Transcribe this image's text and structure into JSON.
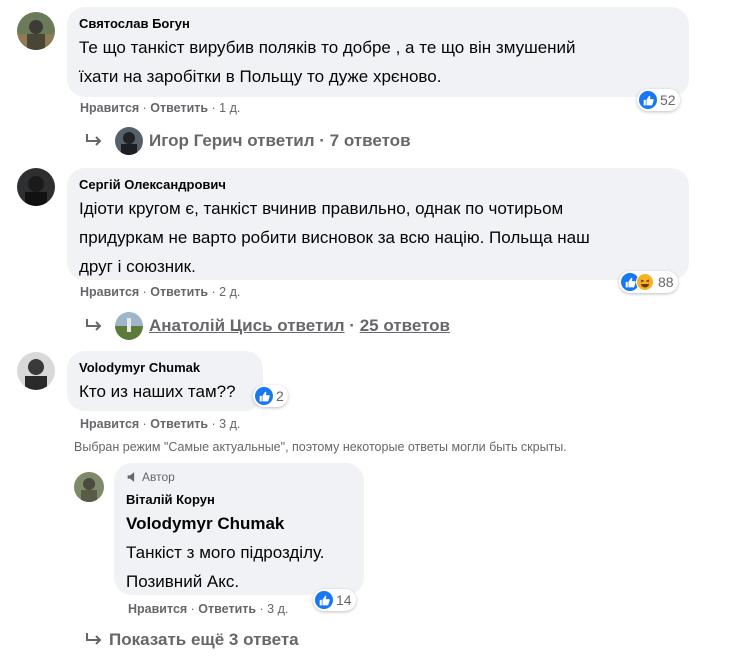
{
  "comments": [
    {
      "author": "Святослав Богун",
      "text_lines": [
        "Те що танкіст вирубив поляків то добре , а те що він змушений",
        "їхати на заробітки в Польщу то дуже хрєново."
      ],
      "like_label": "Нравится",
      "reply_label": "Ответить",
      "time": "1 д.",
      "reaction_count": "52",
      "replies": {
        "name": "Игор Герич ответил",
        "count": "7 ответов"
      }
    },
    {
      "author": "Сергій Олександрович",
      "text_lines": [
        "Ідіоти кругом є, танкіст вчинив правильно, однак по чотирьом",
        "придуркам не варто робити висновок за всю націю. Польща наш",
        "друг і союзник."
      ],
      "like_label": "Нравится",
      "reply_label": "Ответить",
      "time": "2 д.",
      "reaction_count": "88",
      "replies": {
        "name": "Анатолій Цись ответил",
        "count": "25 ответов"
      }
    },
    {
      "author": "Volodymyr Chumak",
      "text_lines": [
        "Кто из наших там??"
      ],
      "like_label": "Нравится",
      "reply_label": "Ответить",
      "time": "3 д.",
      "reaction_count": "2",
      "notice": "Выбран режим \"Самые актуальные\", поэтому некоторые ответы могли быть скрыты."
    }
  ],
  "reply": {
    "badge": "Автор",
    "author": "Віталій Корун",
    "mention": "Volodymyr Chumak",
    "text_lines": [
      "Танкіст з мого підрозділу.",
      "Позивний Акс."
    ],
    "like_label": "Нравится",
    "reply_label": "Ответить",
    "time": "3 д.",
    "reaction_count": "14"
  },
  "show_more": "Показать ещё 3 ответа",
  "colors": {
    "bubble": "#f0f2f5",
    "like_blue": "#1877f2",
    "muted": "#65676b",
    "text": "#050505"
  }
}
